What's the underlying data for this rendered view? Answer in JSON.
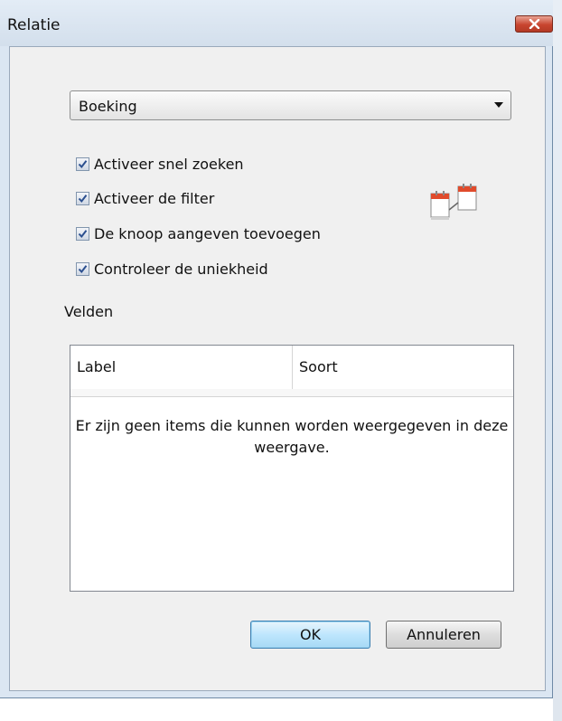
{
  "window": {
    "title": "Relatie"
  },
  "relation_select": {
    "selected": "Boeking"
  },
  "options": [
    {
      "label": "Activeer snel zoeken",
      "checked": true
    },
    {
      "label": "Activeer de filter",
      "checked": true
    },
    {
      "label": "De knoop aangeven toevoegen",
      "checked": true
    },
    {
      "label": "Controleer de uniekheid",
      "checked": true
    }
  ],
  "fields": {
    "section_label": "Velden",
    "columns": [
      "Label",
      "Soort"
    ],
    "empty_message": "Er zijn geen items die kunnen worden weergegeven in deze weergave."
  },
  "buttons": {
    "ok": "OK",
    "cancel": "Annuleren"
  },
  "icons": {
    "close": "close-icon",
    "dropdown": "chevron-down-icon",
    "check": "checkmark-icon",
    "relation": "calendar-link-icon"
  },
  "colors": {
    "close_button": "#c8452f",
    "check_mark": "#2b4f8f",
    "default_button_border": "#3c7fb1"
  }
}
